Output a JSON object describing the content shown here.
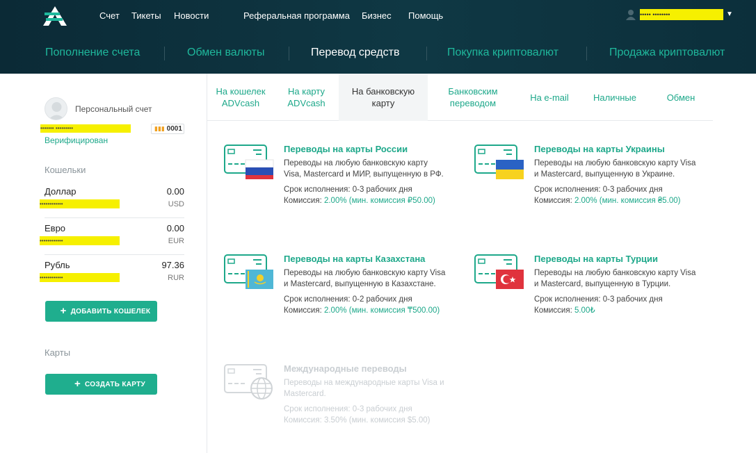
{
  "header": {
    "nav": [
      "Счет",
      "Тикеты",
      "Новости",
      "Реферальная программа",
      "Бизнес",
      "Помощь"
    ],
    "user_name": "••••• ••••••••"
  },
  "main_nav": [
    "Пополнение счета",
    "Обмен валюты",
    "Перевод средств",
    "Покупка криптовалют",
    "Продажа криптовалют"
  ],
  "sidebar": {
    "account_label": "Персональный счет",
    "account_name": "••••••• •••••••••",
    "account_badge": "0001",
    "verified": "Верифицирован",
    "wallets_title": "Кошельки",
    "wallets": [
      {
        "name": "Доллар",
        "amount": "0.00",
        "code": "USD",
        "masked": "••••••••••••"
      },
      {
        "name": "Евро",
        "amount": "0.00",
        "code": "EUR",
        "masked": "••••••••••••"
      },
      {
        "name": "Рубль",
        "amount": "97.36",
        "code": "RUR",
        "masked": "••••••••••••"
      }
    ],
    "add_wallet": "ДОБАВИТЬ КОШЕЛЕК",
    "cards_title": "Карты",
    "create_card": "СОЗДАТЬ КАРТУ"
  },
  "tabs": [
    {
      "label": "На кошелек ADVcash"
    },
    {
      "label": "На карту ADVcash"
    },
    {
      "label": "На банковскую карту"
    },
    {
      "label": "Банковским переводом"
    },
    {
      "label": "На e-mail"
    },
    {
      "label": "Наличные"
    },
    {
      "label": "Обмен"
    }
  ],
  "cards": [
    {
      "title": "Переводы на карты России",
      "desc": "Переводы на любую банковскую карту Visa, Mastercard и МИР, выпущенную в РФ.",
      "term": "Срок исполнения: 0-3 рабочих дня",
      "fee_label": "Комиссия: ",
      "fee": "2.00% (мин. комиссия ₽50.00)"
    },
    {
      "title": "Переводы на карты Украины",
      "desc": "Переводы на любую банковскую карту Visa и Mastercard, выпущенную в Украине.",
      "term": "Срок исполнения: 0-3 рабочих дня",
      "fee_label": "Комиссия: ",
      "fee": "2.00% (мин. комиссия ₴5.00)"
    },
    {
      "title": "Переводы на карты Казахстана",
      "desc": "Переводы на любую банковскую карту Visa и Mastercard, выпущенную в Казахстане.",
      "term": "Срок исполнения: 0-2 рабочих дня",
      "fee_label": "Комиссия: ",
      "fee": "2.00% (мин. комиссия ₸500.00)"
    },
    {
      "title": "Переводы на карты Турции",
      "desc": "Переводы на любую банковскую карту Visa и Mastercard, выпущенную в Турции.",
      "term": "Срок исполнения: 0-3 рабочих дня",
      "fee_label": "Комиссия: ",
      "fee": "5.00₺"
    },
    {
      "title": "Международные переводы",
      "desc": "Переводы на международные карты Visa и Mastercard.",
      "term": "Срок исполнения: 0-3 рабочих дня",
      "fee_label": "Комиссия: ",
      "fee": "3.50% (мин. комиссия $5.00)"
    }
  ],
  "colors": {
    "accent": "#1da88a",
    "header_bg": "#0f3844",
    "highlight": "#f6f000"
  }
}
